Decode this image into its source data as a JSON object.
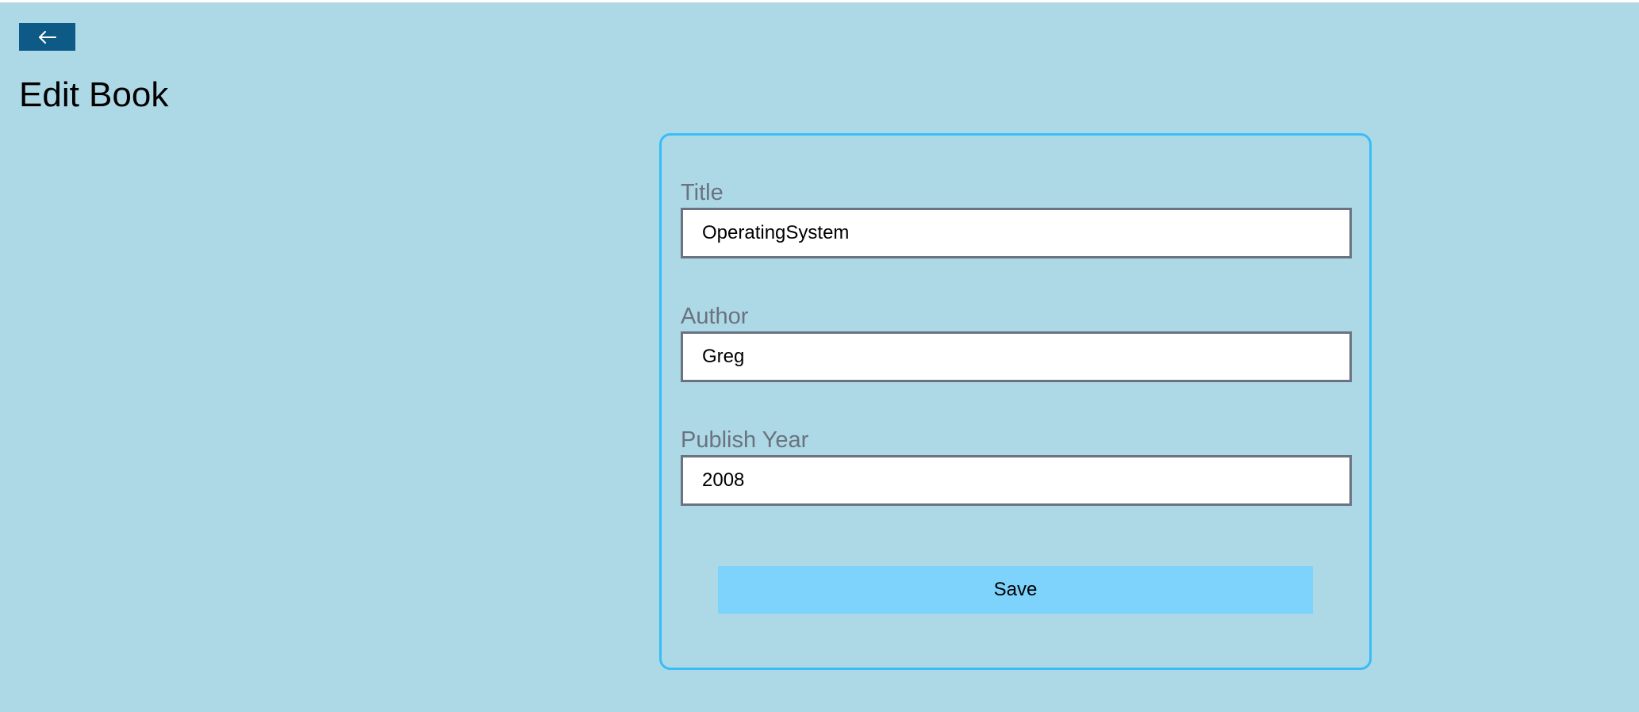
{
  "header": {
    "back_icon": "arrow-left-icon",
    "title": "Edit Book"
  },
  "form": {
    "fields": [
      {
        "label": "Title",
        "value": "OperatingSystem"
      },
      {
        "label": "Author",
        "value": "Greg"
      },
      {
        "label": "Publish Year",
        "value": "2008"
      }
    ],
    "save_label": "Save"
  },
  "colors": {
    "background": "#ADD8E6",
    "back_button": "#0E5A87",
    "card_border": "#38BDF8",
    "save_button": "#7DD3FC",
    "label_text": "#6B7280"
  }
}
